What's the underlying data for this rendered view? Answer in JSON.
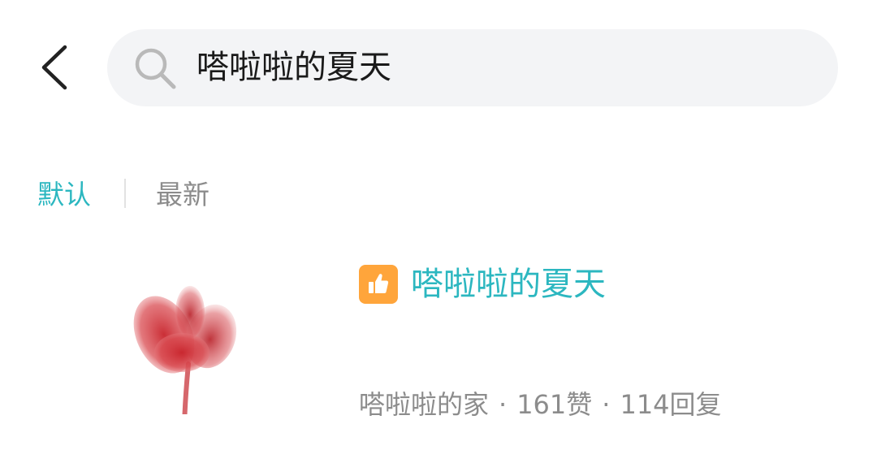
{
  "header": {
    "back_icon": "chevron-left-icon",
    "search": {
      "icon": "search-icon",
      "value": "嗒啦啦的夏天"
    }
  },
  "sort_tabs": {
    "items": [
      {
        "label": "默认",
        "active": true
      },
      {
        "label": "最新",
        "active": false
      }
    ]
  },
  "results": [
    {
      "badge_icon": "thumbs-up-icon",
      "title": "嗒啦啦的夏天",
      "forum": "嗒啦啦的家",
      "separator": "·",
      "likes": "161赞",
      "replies": "114回复"
    }
  ],
  "colors": {
    "accent": "#2cb7c0",
    "badge": "#ffa53b",
    "muted_text": "#8c8c8c",
    "search_bg": "#f3f4f6"
  }
}
